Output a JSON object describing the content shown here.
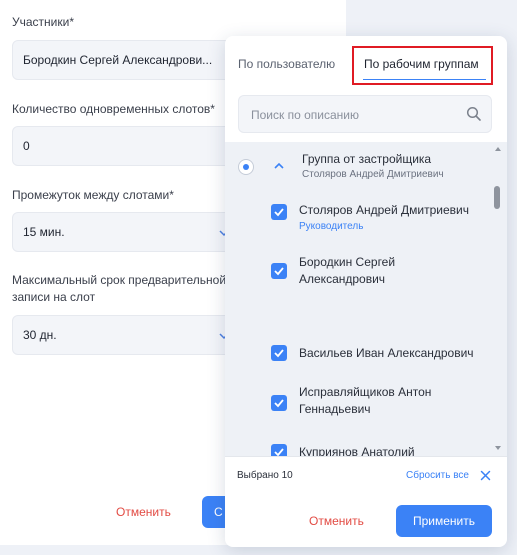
{
  "form": {
    "participants_label": "Участники*",
    "participants_value": "Бородкин Сергей Александрови...",
    "slots_label": "Количество одновременных слотов*",
    "slots_value": "0",
    "interval_label": "Промежуток между слотами*",
    "interval_value": "15 мин.",
    "max_term_label": "Максимальный срок предварительной записи на слот",
    "max_term_value": "30 дн.",
    "cancel_label": "Отменить",
    "submit_label": "С"
  },
  "popup": {
    "tabs": [
      {
        "label": "По пользователю",
        "active": false
      },
      {
        "label": "По рабочим группам",
        "active": true
      }
    ],
    "search": {
      "placeholder": "Поиск по описанию"
    },
    "group": {
      "title": "Группа от застройщика",
      "subtitle": "Столяров Андрей Дмитриевич",
      "selected": true,
      "expanded": true
    },
    "members": [
      {
        "name": "Столяров Андрей Дмитриевич",
        "role": "Руководитель",
        "checked": true
      },
      {
        "name": "Бородкин Сергей Александрович",
        "role": "",
        "checked": true
      },
      {
        "name": "Васильев Иван Александрович",
        "role": "",
        "checked": true
      },
      {
        "name": "Исправляйщиков Антон Геннадьевич",
        "role": "",
        "checked": true
      },
      {
        "name": "Куприянов Анатолий",
        "role": "",
        "checked": true
      }
    ],
    "footer": {
      "selected_text": "Выбрано 10",
      "reset_label": "Сбросить все",
      "cancel_label": "Отменить",
      "apply_label": "Применить"
    }
  },
  "colors": {
    "accent": "#3b82f6",
    "danger": "#e24b43",
    "highlight": "#e01b24"
  }
}
